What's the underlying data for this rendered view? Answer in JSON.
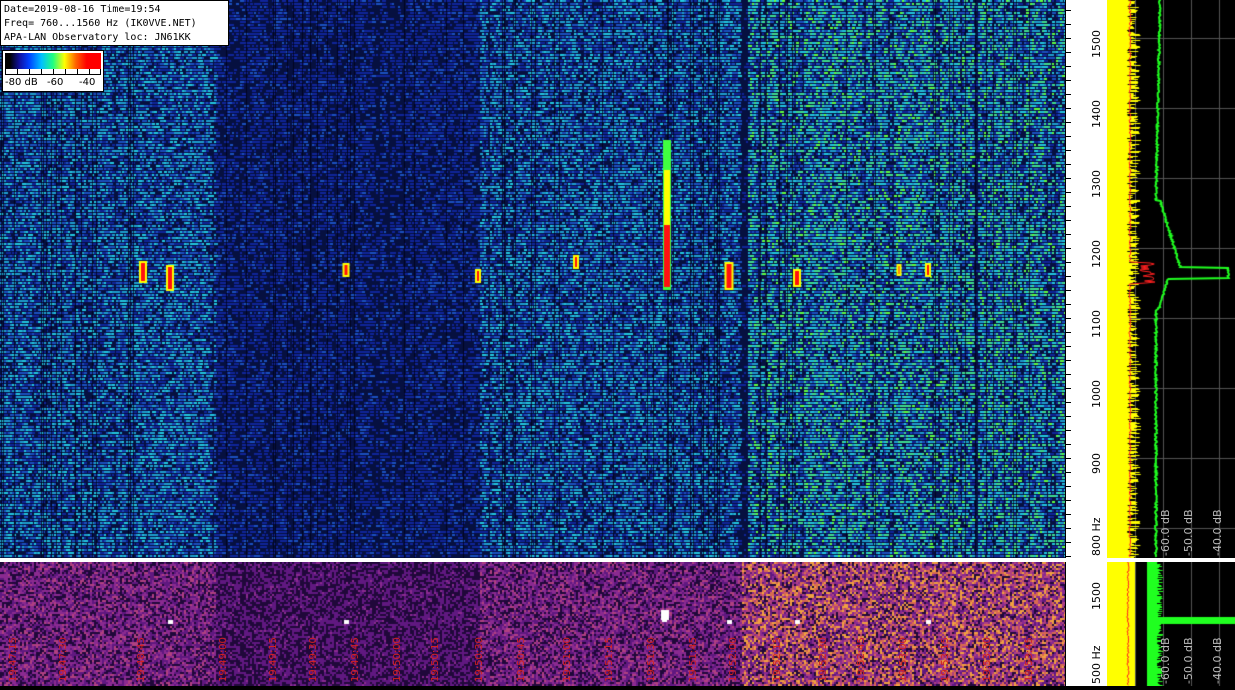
{
  "info": {
    "line1": "Date=2019-08-16 Time=19:54",
    "line2": "Freq= 760...1560 Hz (IK0VVE.NET)",
    "line3": "APA-LAN Observatory loc: JN61KK"
  },
  "legend": {
    "label_80": "-80 dB",
    "label_60": "-60",
    "label_40": "-40"
  },
  "freq_axis": {
    "labels": [
      "1500",
      "1400",
      "1300",
      "1200",
      "1100",
      "1000",
      "900",
      "800 Hz"
    ]
  },
  "sub_axis": {
    "labels": [
      "1500",
      "500 Hz"
    ]
  },
  "spectrum_db_labels": [
    "-60.0 dB",
    "-50.0 dB",
    "-40.0 dB"
  ],
  "sub_db_labels": [
    "-60.0 dB",
    "-50.0 dB",
    "-40.0 dB"
  ],
  "time_labels": [
    "19:47:15",
    "19:47:30",
    "19:48:45",
    "19:49:00",
    "19:49:15",
    "19:49:30",
    "19:49:45",
    "19:50:00",
    "19:50:15",
    "19:50:30",
    "19:50:45",
    "19:51:00",
    "19:51:15",
    "19:51:30",
    "19:51:45",
    "19:52:00",
    "19:52:15",
    "19:52:30",
    "19:52:45",
    "19:53:00",
    "19:53:15",
    "19:53:30",
    "19:53:45"
  ],
  "colors": {
    "waterfall_bg": "#0a1a5a",
    "waterfall_noise": "#1ea0d0",
    "sub_bg": "#2a1040",
    "spectrum_yellow": "#ffff00",
    "spectrum_green": "#20ff20",
    "spectrum_red": "#ff2020",
    "time_label": "#d42020"
  }
}
